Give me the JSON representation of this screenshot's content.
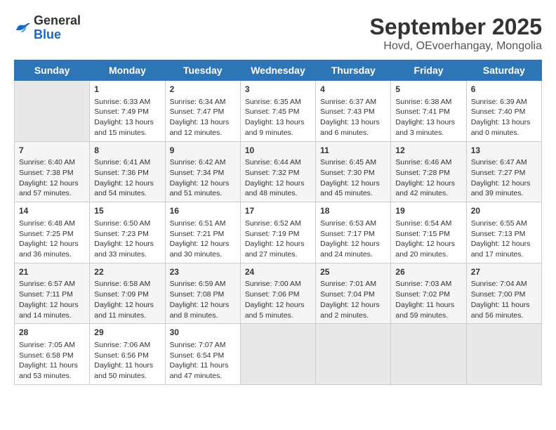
{
  "header": {
    "logo_general": "General",
    "logo_blue": "Blue",
    "month_title": "September 2025",
    "location": "Hovd, OEvoerhangay, Mongolia"
  },
  "days_of_week": [
    "Sunday",
    "Monday",
    "Tuesday",
    "Wednesday",
    "Thursday",
    "Friday",
    "Saturday"
  ],
  "weeks": [
    [
      {
        "day": "",
        "sunrise": "",
        "sunset": "",
        "daylight": "",
        "empty": true
      },
      {
        "day": "1",
        "sunrise": "Sunrise: 6:33 AM",
        "sunset": "Sunset: 7:49 PM",
        "daylight": "Daylight: 13 hours and 15 minutes."
      },
      {
        "day": "2",
        "sunrise": "Sunrise: 6:34 AM",
        "sunset": "Sunset: 7:47 PM",
        "daylight": "Daylight: 13 hours and 12 minutes."
      },
      {
        "day": "3",
        "sunrise": "Sunrise: 6:35 AM",
        "sunset": "Sunset: 7:45 PM",
        "daylight": "Daylight: 13 hours and 9 minutes."
      },
      {
        "day": "4",
        "sunrise": "Sunrise: 6:37 AM",
        "sunset": "Sunset: 7:43 PM",
        "daylight": "Daylight: 13 hours and 6 minutes."
      },
      {
        "day": "5",
        "sunrise": "Sunrise: 6:38 AM",
        "sunset": "Sunset: 7:41 PM",
        "daylight": "Daylight: 13 hours and 3 minutes."
      },
      {
        "day": "6",
        "sunrise": "Sunrise: 6:39 AM",
        "sunset": "Sunset: 7:40 PM",
        "daylight": "Daylight: 13 hours and 0 minutes."
      }
    ],
    [
      {
        "day": "7",
        "sunrise": "Sunrise: 6:40 AM",
        "sunset": "Sunset: 7:38 PM",
        "daylight": "Daylight: 12 hours and 57 minutes."
      },
      {
        "day": "8",
        "sunrise": "Sunrise: 6:41 AM",
        "sunset": "Sunset: 7:36 PM",
        "daylight": "Daylight: 12 hours and 54 minutes."
      },
      {
        "day": "9",
        "sunrise": "Sunrise: 6:42 AM",
        "sunset": "Sunset: 7:34 PM",
        "daylight": "Daylight: 12 hours and 51 minutes."
      },
      {
        "day": "10",
        "sunrise": "Sunrise: 6:44 AM",
        "sunset": "Sunset: 7:32 PM",
        "daylight": "Daylight: 12 hours and 48 minutes."
      },
      {
        "day": "11",
        "sunrise": "Sunrise: 6:45 AM",
        "sunset": "Sunset: 7:30 PM",
        "daylight": "Daylight: 12 hours and 45 minutes."
      },
      {
        "day": "12",
        "sunrise": "Sunrise: 6:46 AM",
        "sunset": "Sunset: 7:28 PM",
        "daylight": "Daylight: 12 hours and 42 minutes."
      },
      {
        "day": "13",
        "sunrise": "Sunrise: 6:47 AM",
        "sunset": "Sunset: 7:27 PM",
        "daylight": "Daylight: 12 hours and 39 minutes."
      }
    ],
    [
      {
        "day": "14",
        "sunrise": "Sunrise: 6:48 AM",
        "sunset": "Sunset: 7:25 PM",
        "daylight": "Daylight: 12 hours and 36 minutes."
      },
      {
        "day": "15",
        "sunrise": "Sunrise: 6:50 AM",
        "sunset": "Sunset: 7:23 PM",
        "daylight": "Daylight: 12 hours and 33 minutes."
      },
      {
        "day": "16",
        "sunrise": "Sunrise: 6:51 AM",
        "sunset": "Sunset: 7:21 PM",
        "daylight": "Daylight: 12 hours and 30 minutes."
      },
      {
        "day": "17",
        "sunrise": "Sunrise: 6:52 AM",
        "sunset": "Sunset: 7:19 PM",
        "daylight": "Daylight: 12 hours and 27 minutes."
      },
      {
        "day": "18",
        "sunrise": "Sunrise: 6:53 AM",
        "sunset": "Sunset: 7:17 PM",
        "daylight": "Daylight: 12 hours and 24 minutes."
      },
      {
        "day": "19",
        "sunrise": "Sunrise: 6:54 AM",
        "sunset": "Sunset: 7:15 PM",
        "daylight": "Daylight: 12 hours and 20 minutes."
      },
      {
        "day": "20",
        "sunrise": "Sunrise: 6:55 AM",
        "sunset": "Sunset: 7:13 PM",
        "daylight": "Daylight: 12 hours and 17 minutes."
      }
    ],
    [
      {
        "day": "21",
        "sunrise": "Sunrise: 6:57 AM",
        "sunset": "Sunset: 7:11 PM",
        "daylight": "Daylight: 12 hours and 14 minutes."
      },
      {
        "day": "22",
        "sunrise": "Sunrise: 6:58 AM",
        "sunset": "Sunset: 7:09 PM",
        "daylight": "Daylight: 12 hours and 11 minutes."
      },
      {
        "day": "23",
        "sunrise": "Sunrise: 6:59 AM",
        "sunset": "Sunset: 7:08 PM",
        "daylight": "Daylight: 12 hours and 8 minutes."
      },
      {
        "day": "24",
        "sunrise": "Sunrise: 7:00 AM",
        "sunset": "Sunset: 7:06 PM",
        "daylight": "Daylight: 12 hours and 5 minutes."
      },
      {
        "day": "25",
        "sunrise": "Sunrise: 7:01 AM",
        "sunset": "Sunset: 7:04 PM",
        "daylight": "Daylight: 12 hours and 2 minutes."
      },
      {
        "day": "26",
        "sunrise": "Sunrise: 7:03 AM",
        "sunset": "Sunset: 7:02 PM",
        "daylight": "Daylight: 11 hours and 59 minutes."
      },
      {
        "day": "27",
        "sunrise": "Sunrise: 7:04 AM",
        "sunset": "Sunset: 7:00 PM",
        "daylight": "Daylight: 11 hours and 56 minutes."
      }
    ],
    [
      {
        "day": "28",
        "sunrise": "Sunrise: 7:05 AM",
        "sunset": "Sunset: 6:58 PM",
        "daylight": "Daylight: 11 hours and 53 minutes."
      },
      {
        "day": "29",
        "sunrise": "Sunrise: 7:06 AM",
        "sunset": "Sunset: 6:56 PM",
        "daylight": "Daylight: 11 hours and 50 minutes."
      },
      {
        "day": "30",
        "sunrise": "Sunrise: 7:07 AM",
        "sunset": "Sunset: 6:54 PM",
        "daylight": "Daylight: 11 hours and 47 minutes."
      },
      {
        "day": "",
        "sunrise": "",
        "sunset": "",
        "daylight": "",
        "empty": true
      },
      {
        "day": "",
        "sunrise": "",
        "sunset": "",
        "daylight": "",
        "empty": true
      },
      {
        "day": "",
        "sunrise": "",
        "sunset": "",
        "daylight": "",
        "empty": true
      },
      {
        "day": "",
        "sunrise": "",
        "sunset": "",
        "daylight": "",
        "empty": true
      }
    ]
  ]
}
